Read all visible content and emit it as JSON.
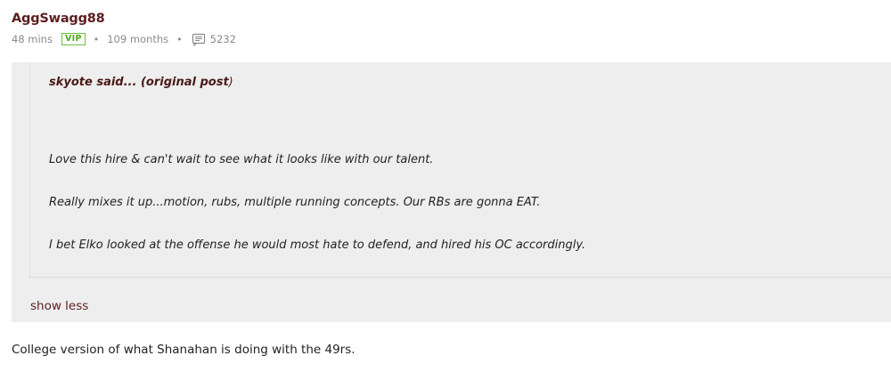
{
  "post": {
    "username": "AggSwagg88",
    "meta": {
      "time_ago": "48 mins",
      "badge": "VIP",
      "membership": "109 months",
      "message_icon": "message-icon",
      "post_count": "5232"
    },
    "quote": {
      "author_said": "skyote said...",
      "original_link": "(original post",
      "paren_close": ")",
      "paragraphs": [
        "Love this hire & can't wait to see what it looks like with our talent.",
        "Really mixes it up...motion, rubs, multiple running concepts. Our RBs are gonna EAT.",
        "I bet Elko looked at the offense he would most hate to defend, and hired his OC accordingly."
      ],
      "show_less": "show less"
    },
    "body": "College version of what Shanahan is doing with the 49rs."
  },
  "colors": {
    "username": "#5b1f1f",
    "vip_badge": "#4caa1c",
    "quote_bg": "#eeeeee",
    "meta_text": "#8a8a8a"
  }
}
